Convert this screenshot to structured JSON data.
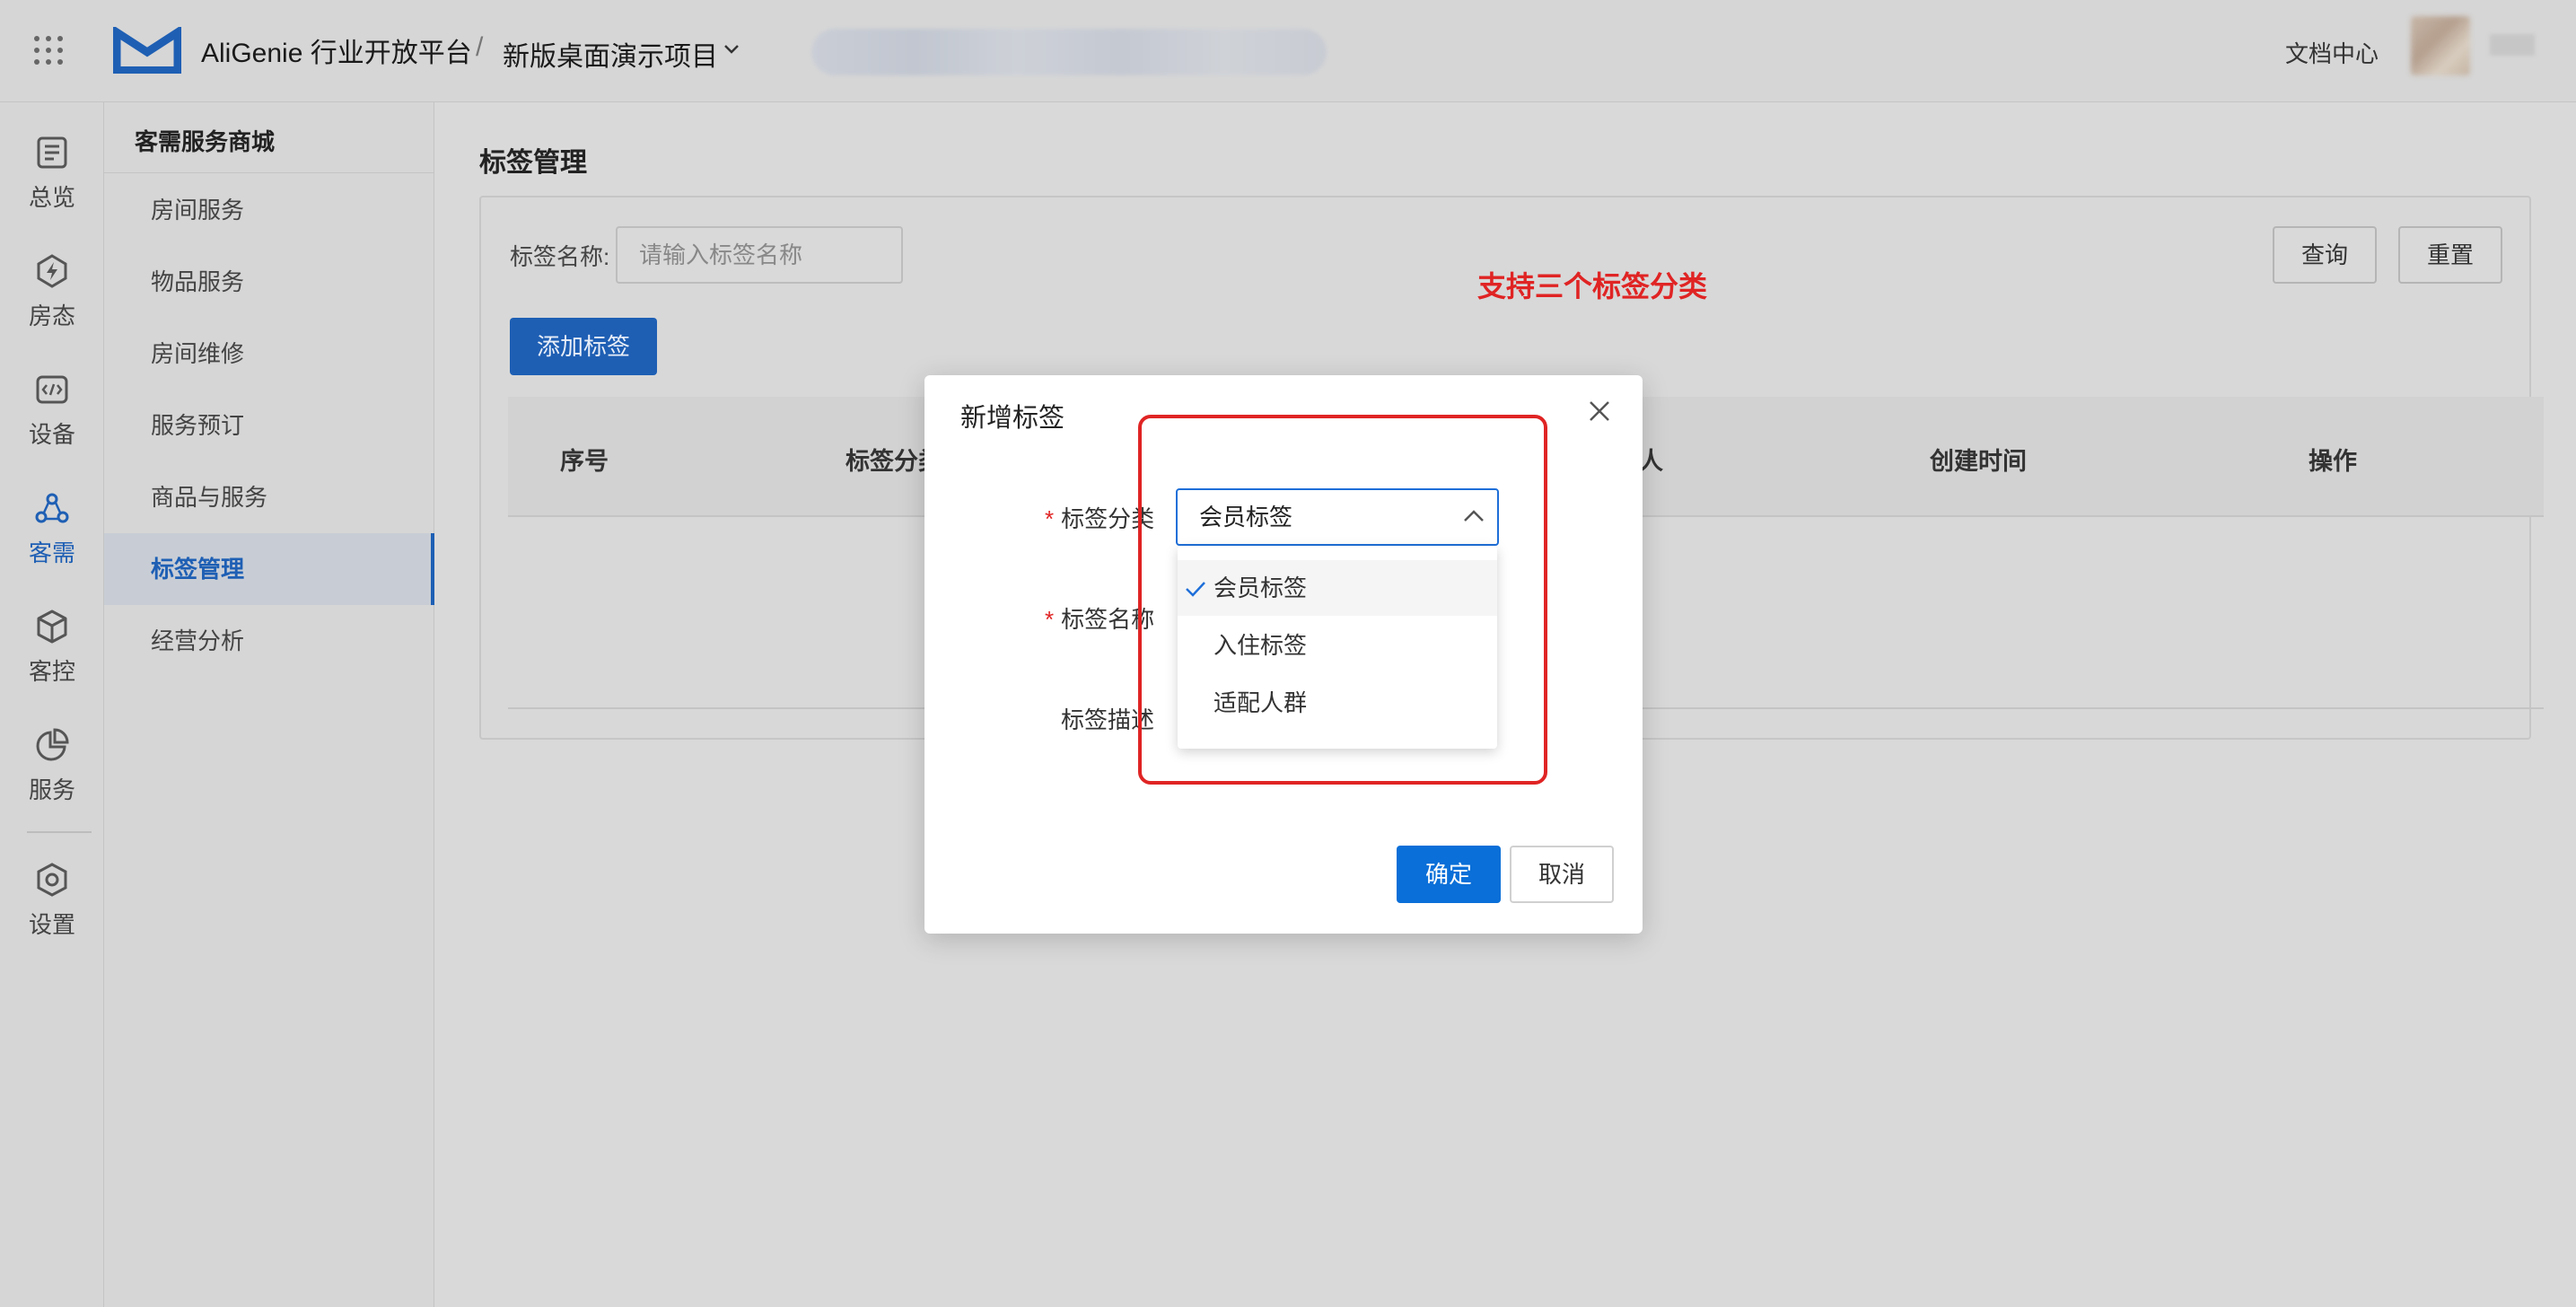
{
  "topbar": {
    "brand": "AliGenie 行业开放平台",
    "separator": "/",
    "project": "新版桌面演示项目",
    "doc_center": "文档中心"
  },
  "icon_nav": {
    "items": [
      {
        "label": "总览",
        "icon": "list-icon"
      },
      {
        "label": "房态",
        "icon": "lightning-icon"
      },
      {
        "label": "设备",
        "icon": "code-icon"
      },
      {
        "label": "客需",
        "icon": "network-icon",
        "active": true
      },
      {
        "label": "客控",
        "icon": "cube-icon"
      },
      {
        "label": "服务",
        "icon": "pie-icon"
      },
      {
        "label": "设置",
        "icon": "gear-icon"
      }
    ]
  },
  "sub_nav": {
    "title": "客需服务商城",
    "items": [
      {
        "label": "房间服务"
      },
      {
        "label": "物品服务"
      },
      {
        "label": "房间维修"
      },
      {
        "label": "服务预订"
      },
      {
        "label": "商品与服务"
      },
      {
        "label": "标签管理",
        "active": true
      },
      {
        "label": "经营分析"
      }
    ]
  },
  "main": {
    "title": "标签管理",
    "filter": {
      "label": "标签名称:",
      "placeholder": "请输入标签名称"
    },
    "query_label": "查询",
    "reset_label": "重置",
    "add_label": "添加标签",
    "table": {
      "columns": [
        "序号",
        "标签分类",
        "人",
        "创建时间",
        "操作"
      ]
    }
  },
  "annotation": "支持三个标签分类",
  "modal": {
    "title": "新增标签",
    "fields": {
      "category_label": "标签分类",
      "name_label": "标签名称",
      "desc_label": "标签描述"
    },
    "select_value": "会员标签",
    "options": [
      "会员标签",
      "入住标签",
      "适配人群"
    ],
    "confirm_label": "确定",
    "cancel_label": "取消"
  },
  "colors": {
    "primary": "#0a6fd8",
    "annotation": "#e02424",
    "active_nav": "#1e5fb4"
  }
}
